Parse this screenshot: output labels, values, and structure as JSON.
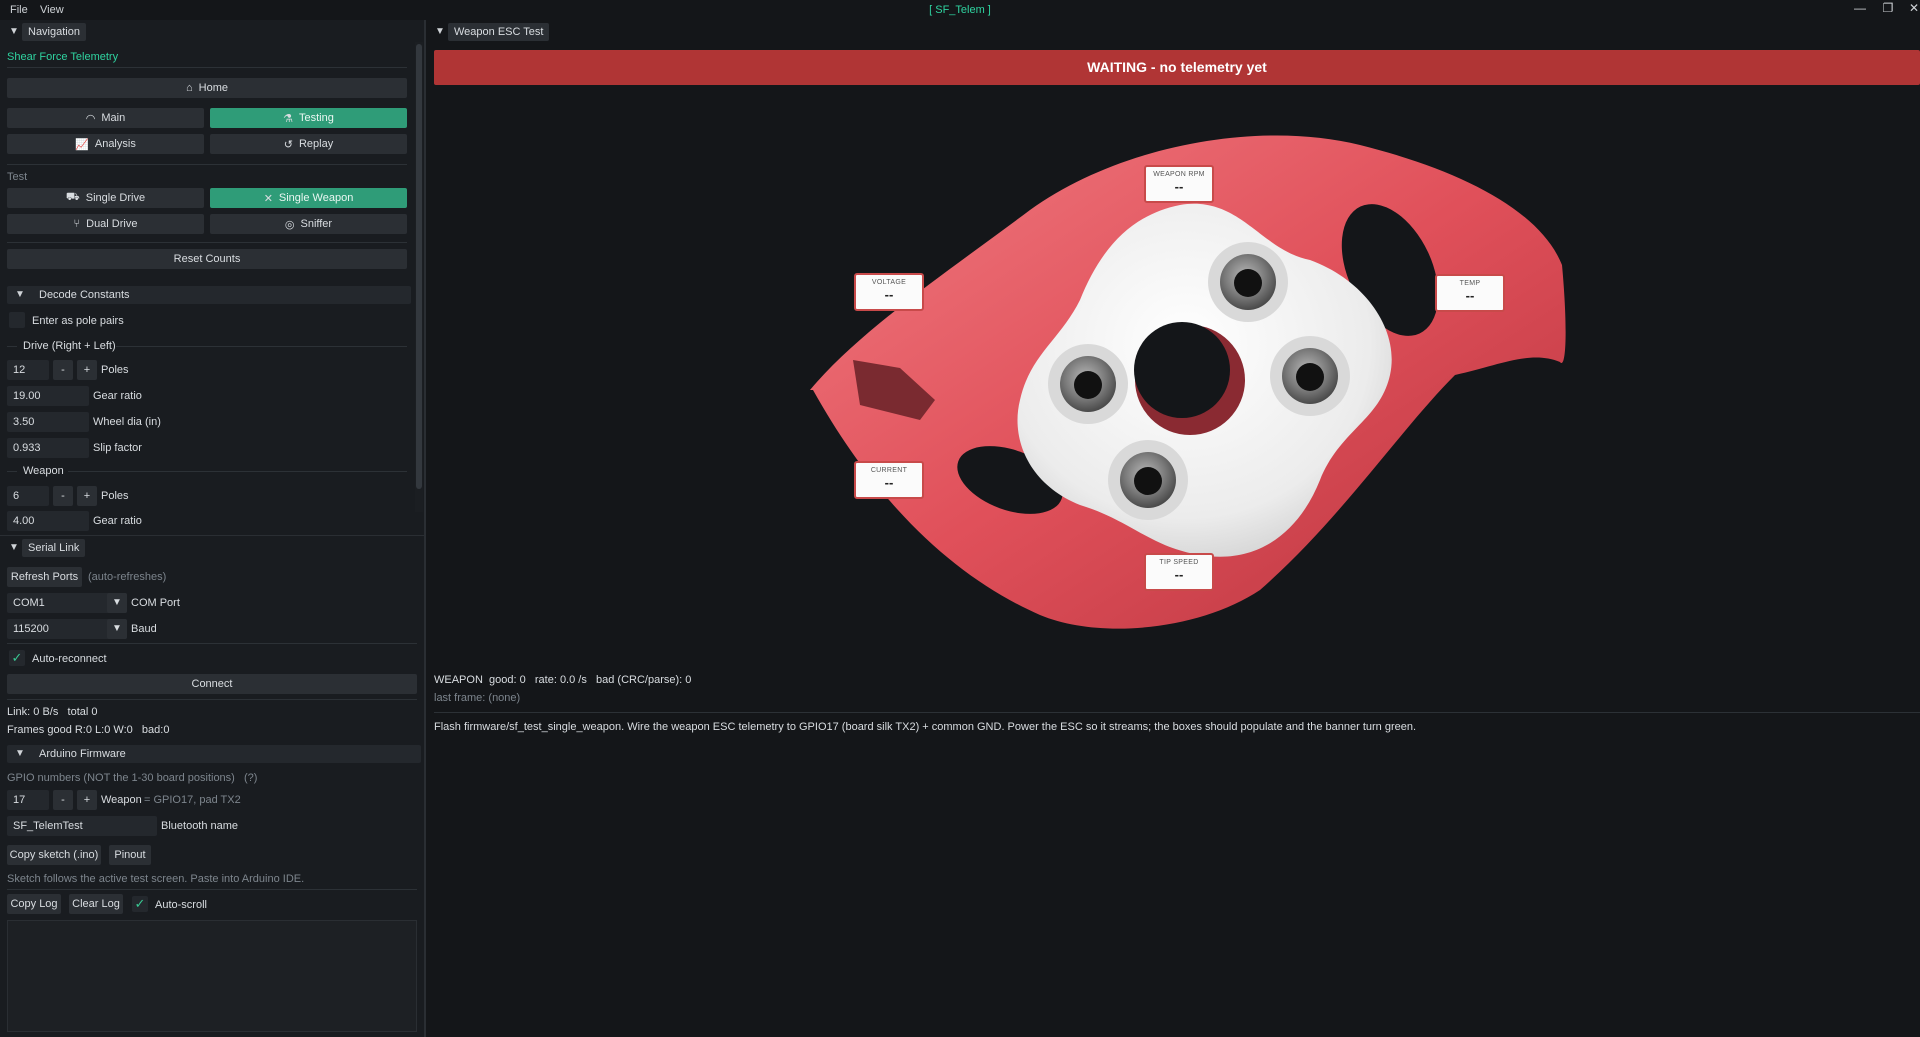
{
  "window": {
    "menu": [
      "File",
      "View"
    ],
    "title": "[ SF_Telem ]",
    "controls": {
      "minimize": "—",
      "restore": "❐",
      "close": "✕"
    }
  },
  "nav_panel": {
    "tab_label": "Navigation",
    "app_name": "Shear Force Telemetry",
    "home_label": "Home",
    "main_label": "Main",
    "testing_label": "Testing",
    "analysis_label": "Analysis",
    "replay_label": "Replay",
    "test_heading": "Test",
    "single_drive_label": "Single Drive",
    "single_weapon_label": "Single Weapon",
    "dual_drive_label": "Dual Drive",
    "sniffer_label": "Sniffer",
    "reset_counts_label": "Reset Counts",
    "decode_header": "Decode Constants",
    "pole_pairs_label": "Enter as pole pairs",
    "drive_group_label": "Drive (Right + Left)",
    "drive_poles_value": "12",
    "drive_poles_label": "Poles",
    "gear_ratio_value": "19.00",
    "gear_ratio_label": "Gear ratio",
    "wheel_dia_value": "3.50",
    "wheel_dia_label": "Wheel dia (in)",
    "slip_factor_value": "0.933",
    "slip_factor_label": "Slip factor",
    "weapon_group_label": "Weapon",
    "weapon_poles_value": "6",
    "weapon_poles_label": "Poles",
    "weapon_gear_value": "4.00",
    "weapon_gear_label": "Gear ratio",
    "minus": "-",
    "plus": "+"
  },
  "serial_panel": {
    "tab_label": "Serial Link",
    "refresh_label": "Refresh Ports",
    "auto_refresh_note": "(auto-refreshes)",
    "com_value": "COM1",
    "com_label": "COM Port",
    "baud_value": "115200",
    "baud_label": "Baud",
    "auto_reconnect_label": "Auto-reconnect",
    "connect_label": "Connect",
    "link_stats": "Link: 0 B/s   total 0",
    "frame_stats": "Frames good R:0 L:0 W:0   bad:0",
    "firmware_header": "Arduino Firmware",
    "gpio_note": "GPIO numbers (NOT the 1-30 board positions)   (?)",
    "gpio_value": "17",
    "gpio_label": "Weapon",
    "gpio_hint": "= GPIO17, pad TX2",
    "bt_value": "SF_TelemTest",
    "bt_label": "Bluetooth name",
    "copy_sketch_label": "Copy sketch (.ino)",
    "pinout_label": "Pinout",
    "sketch_note": "Sketch follows the active test screen. Paste into Arduino IDE.",
    "copy_log_label": "Copy Log",
    "clear_log_label": "Clear Log",
    "auto_scroll_label": "Auto-scroll",
    "check_mark": "✓"
  },
  "test_panel": {
    "tab_label": "Weapon ESC Test",
    "banner_text": "WAITING - no telemetry yet",
    "boxes": {
      "rpm": {
        "title": "WEAPON RPM",
        "value": "--"
      },
      "voltage": {
        "title": "VOLTAGE",
        "value": "--"
      },
      "temp": {
        "title": "TEMP",
        "value": "--"
      },
      "current": {
        "title": "CURRENT",
        "value": "--"
      },
      "tip_speed": {
        "title": "TIP SPEED",
        "value": "--"
      }
    },
    "stats_line": "WEAPON  good: 0   rate: 0.0 /s   bad (CRC/parse): 0",
    "last_frame": "last frame: (none)",
    "instructions": "Flash firmware/sf_test_single_weapon. Wire the weapon ESC telemetry to GPIO17 (board silk TX2) + common GND. Power the ESC so it streams; the boxes should populate and the banner turn green."
  },
  "colors": {
    "accent": "#2f9c78",
    "title": "#2fd3a0",
    "banner": "#b03535",
    "weapon": "#e0505a",
    "hub": "#f2f2f2"
  },
  "icons": [
    "home-icon",
    "gauge-icon",
    "flask-icon",
    "chart-icon",
    "history-icon",
    "car-icon",
    "crossed-swords-icon",
    "fork-icon",
    "radar-icon",
    "triangle-down-icon",
    "check-icon"
  ]
}
